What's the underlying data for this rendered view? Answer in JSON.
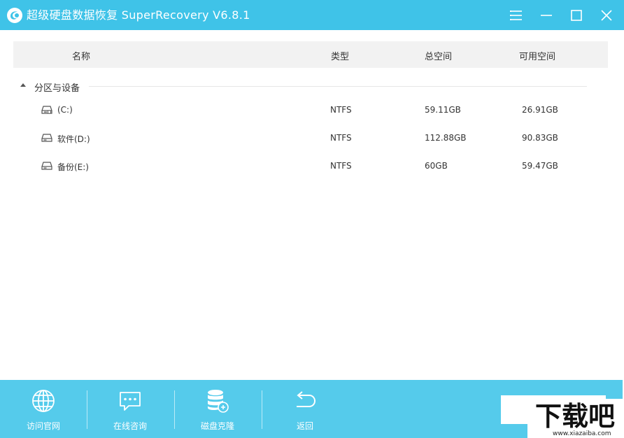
{
  "app": {
    "title": "超级硬盘数据恢复 SuperRecovery V6.8.1"
  },
  "window_controls": [
    "menu-icon",
    "minimize-icon",
    "maximize-icon",
    "close-icon"
  ],
  "table": {
    "headers": {
      "name": "名称",
      "type": "类型",
      "total": "总空间",
      "free": "可用空间"
    },
    "group_label": "分区与设备",
    "rows": [
      {
        "name": "(C:)",
        "type": "NTFS",
        "total": "59.11GB",
        "free": "26.91GB",
        "icon": "system-drive-icon"
      },
      {
        "name": "软件(D:)",
        "type": "NTFS",
        "total": "112.88GB",
        "free": "90.83GB",
        "icon": "drive-icon"
      },
      {
        "name": "备份(E:)",
        "type": "NTFS",
        "total": "60GB",
        "free": "59.47GB",
        "icon": "drive-icon"
      }
    ]
  },
  "toolbar": {
    "visit_site": "访问官网",
    "online_consult": "在线咨询",
    "disk_clone": "磁盘克隆",
    "back": "返回"
  },
  "watermark": {
    "brand": "下载吧",
    "url": "www.xiazaiba.com"
  },
  "colors": {
    "titlebar": "#3fc3e8",
    "bottombar": "#55cbeb",
    "header_bg": "#f2f2f2"
  }
}
